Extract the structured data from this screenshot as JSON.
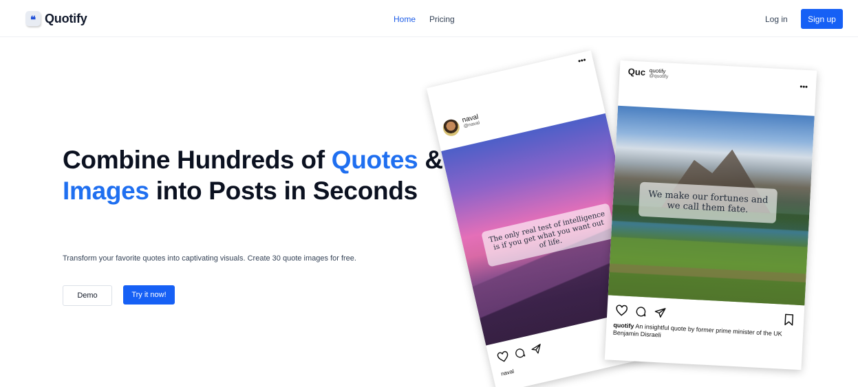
{
  "header": {
    "logo_mark": "❝",
    "logo_text": "Quotify",
    "nav": [
      {
        "label": "Home",
        "active": true
      },
      {
        "label": "Pricing",
        "active": false
      }
    ],
    "login_label": "Log in",
    "signup_label": "Sign up"
  },
  "hero": {
    "title_part1": "Combine Hundreds of ",
    "title_accent1": "Quotes",
    "title_part2": " & ",
    "title_accent2": "Images",
    "title_part3": " into Posts in Seconds",
    "subtitle": "Transform your favorite quotes into captivating visuals. Create 30 quote images for free.",
    "demo_label": "Demo",
    "try_label": "Try it now!"
  },
  "post_back": {
    "username": "naval",
    "handle": "@naval",
    "more": "•••",
    "quote": "The only real test of intelligence is if you get what you want out of life.",
    "footer_user": "naval"
  },
  "post_front": {
    "brand": "Quc",
    "username": "quotify",
    "handle": "@quotify",
    "more": "•••",
    "quote": "We make our fortunes and we call them fate.",
    "caption_user": "quotify",
    "caption_text": " An insightful quote by former prime minister of the UK Benjamin Disraeli"
  },
  "colors": {
    "accent": "#1f6ff0",
    "button": "#1660f5"
  }
}
